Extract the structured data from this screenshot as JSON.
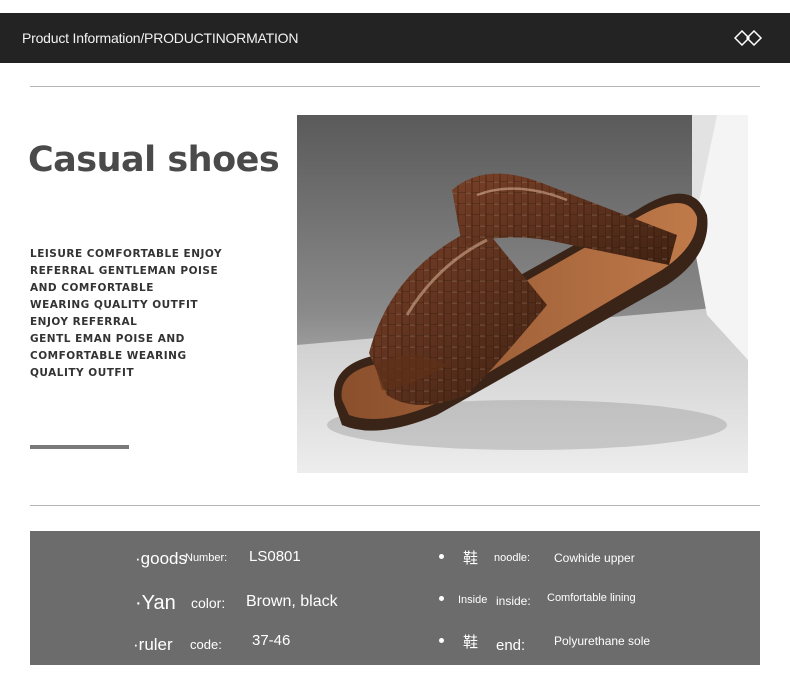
{
  "header": {
    "title": "Product Information/PRODUCTINORMATION",
    "icon": "diamond-pair-icon"
  },
  "intro": {
    "heading": "Casual shoes",
    "description_lines": [
      "LEISURE COMFORTABLE ENJOY",
      "REFERRAL GENTLEMAN POISE",
      "AND COMFORTABLE",
      "WEARING QUALITY OUTFIT",
      "ENJOY REFERRAL",
      "GENTL EMAN POISE AND",
      "COMFORTABLE WEARING",
      "QUALITY OUTFIT"
    ]
  },
  "product_image": {
    "subject": "brown crocodile-pattern leather slide sandal",
    "colors": {
      "leather": "#5a2f1c",
      "footbed": "#a5653c",
      "sole": "#3a2418"
    }
  },
  "specs": {
    "left": [
      {
        "label": "·goods",
        "sublabel": "Number:",
        "value": "LS0801"
      },
      {
        "label": "·Yan",
        "sublabel": "color:",
        "value": "Brown, black"
      },
      {
        "label": "·ruler",
        "sublabel": "code:",
        "value": "37-46"
      }
    ],
    "right": [
      {
        "label": "鞋",
        "sublabel": "noodle:",
        "value": "Cowhide upper"
      },
      {
        "label": "Inside",
        "sublabel": "inside:",
        "value": "Comfortable lining"
      },
      {
        "label": "鞋",
        "sublabel": "end:",
        "value": "Polyurethane sole"
      }
    ]
  },
  "colors": {
    "header_bg": "#232323",
    "spec_bg": "#6c6c6c",
    "heading_text": "#4a4a4a"
  }
}
